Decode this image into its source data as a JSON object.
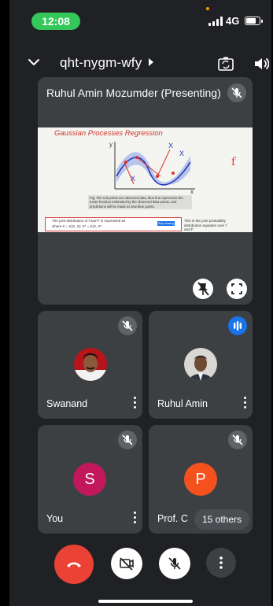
{
  "status_bar": {
    "time": "12:08",
    "network": "4G",
    "battery_level": 0.8
  },
  "header": {
    "meeting_code": "qht-nygm-wfy"
  },
  "presenter_tile": {
    "name": "Ruhul Amin Mozumder (Presenting)",
    "slide": {
      "title": "Gaussian Processes Regression",
      "caption": "Fig. The red points are observed data, blue line represents the mean function estimated by the observed data points, and predictions will be made at new blue points.",
      "formula_intro": "The joint distribution of f and f* is expressed as",
      "formula_where": "where K = K(X, X); K* = K(X, X*",
      "side_note": "This is the joint probability distribution equation over f and f*",
      "popup_button": "Stop sharing",
      "annotation": "f"
    }
  },
  "participants": [
    {
      "name": "Swanand",
      "muted": true
    },
    {
      "name": "Ruhul Amin",
      "speaking": true
    },
    {
      "name": "You",
      "initial": "S",
      "muted": true,
      "color": "#c2185b"
    },
    {
      "name": "Prof. C",
      "initial": "P",
      "muted": true,
      "color": "#f4511e"
    }
  ],
  "others_badge": "15 others",
  "colors": {
    "end_call": "#ea4335",
    "speaking": "#1a73e8",
    "tile_bg": "#3c4043",
    "status_green": "#34c759"
  }
}
